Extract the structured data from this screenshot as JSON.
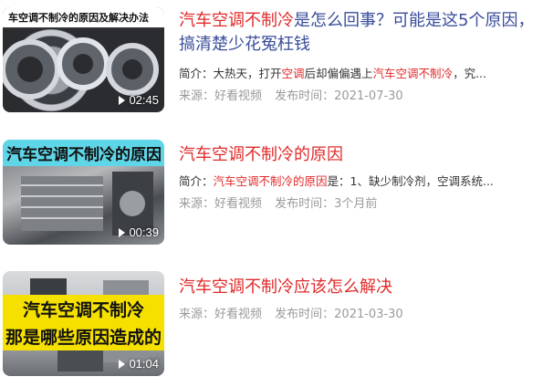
{
  "results": [
    {
      "thumb_overlay": "车空调不制冷的原因及解决办法",
      "duration": "02:45",
      "title_hl": "汽车空调不制冷",
      "title_rest": "是怎么回事？可能是这5个原因，搞清楚少花冤枉钱",
      "abstract_prefix": "简介：大热天，打开",
      "abstract_hl1": "空调",
      "abstract_mid": "后却偏偏遇上",
      "abstract_hl2": "汽车空调不制冷",
      "abstract_suffix": "，究...",
      "source": "来源：好看视频",
      "date": "发布时间：2021-07-30"
    },
    {
      "thumb_overlay": "汽车空调不制冷的原因",
      "duration": "00:39",
      "title_hl": "汽车空调不制冷",
      "title_rest": "的原因",
      "abstract_prefix": "简介：",
      "abstract_hl1": "汽车空调不制冷的原因",
      "abstract_mid": "是：1、缺少制冷剂，空调系统...",
      "abstract_hl2": "",
      "abstract_suffix": "",
      "source": "来源：好看视频",
      "date": "发布时间：3个月前"
    },
    {
      "thumb_overlay_1": "汽车空调不制冷",
      "thumb_overlay_2": "那是哪些原因造成的",
      "duration": "01:04",
      "title_hl": "汽车空调不制冷",
      "title_rest": "应该怎么解决",
      "source": "来源：好看视频",
      "date": "发布时间：2021-03-30"
    }
  ]
}
